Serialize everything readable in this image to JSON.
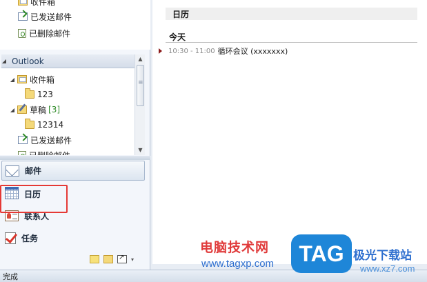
{
  "nav": {
    "top_list": [
      {
        "label": "收件箱",
        "icon": "inbox-icon"
      },
      {
        "label": "已发送邮件",
        "icon": "sent-icon"
      },
      {
        "label": "已删除邮件",
        "icon": "trash-icon"
      }
    ],
    "account": {
      "label": "Outlook",
      "expander": "◢"
    },
    "tree": [
      {
        "label": "收件箱",
        "expander": "◢",
        "icon": "inbox-icon",
        "count": ""
      },
      {
        "label": "123",
        "expander": "",
        "icon": "folder-icon",
        "count": ""
      },
      {
        "label": "草稿",
        "expander": "◢",
        "icon": "draft-icon",
        "count": "[3]"
      },
      {
        "label": "12314",
        "expander": "",
        "icon": "folder-icon",
        "count": ""
      },
      {
        "label": "已发送邮件",
        "expander": "",
        "icon": "sent-icon",
        "count": ""
      },
      {
        "label": "已删除邮件",
        "expander": "",
        "icon": "trash-icon",
        "count": ""
      }
    ],
    "scroll_up": "▲",
    "scroll_down": "▼",
    "buttons": {
      "mail": "邮件",
      "calendar": "日历",
      "contacts": "联系人",
      "tasks": "任务"
    },
    "toolbar_more": "▾"
  },
  "calendar": {
    "header": "日历",
    "day_title": "今天",
    "appointments": [
      {
        "time": "10:30 - 11:00",
        "title": "循环会议 (xxxxxxx)"
      }
    ]
  },
  "status": {
    "text": "完成"
  },
  "watermark": {
    "site_name": "电脑技术网",
    "site_url": "www.tagxp.com",
    "logo": "TAG",
    "side_text": "极光下载站",
    "side_url": "www.xz7.com"
  },
  "colors": {
    "highlight": "#e53935",
    "appointment_marker": "#8b1a1a",
    "count_green": "#2d8a26"
  }
}
